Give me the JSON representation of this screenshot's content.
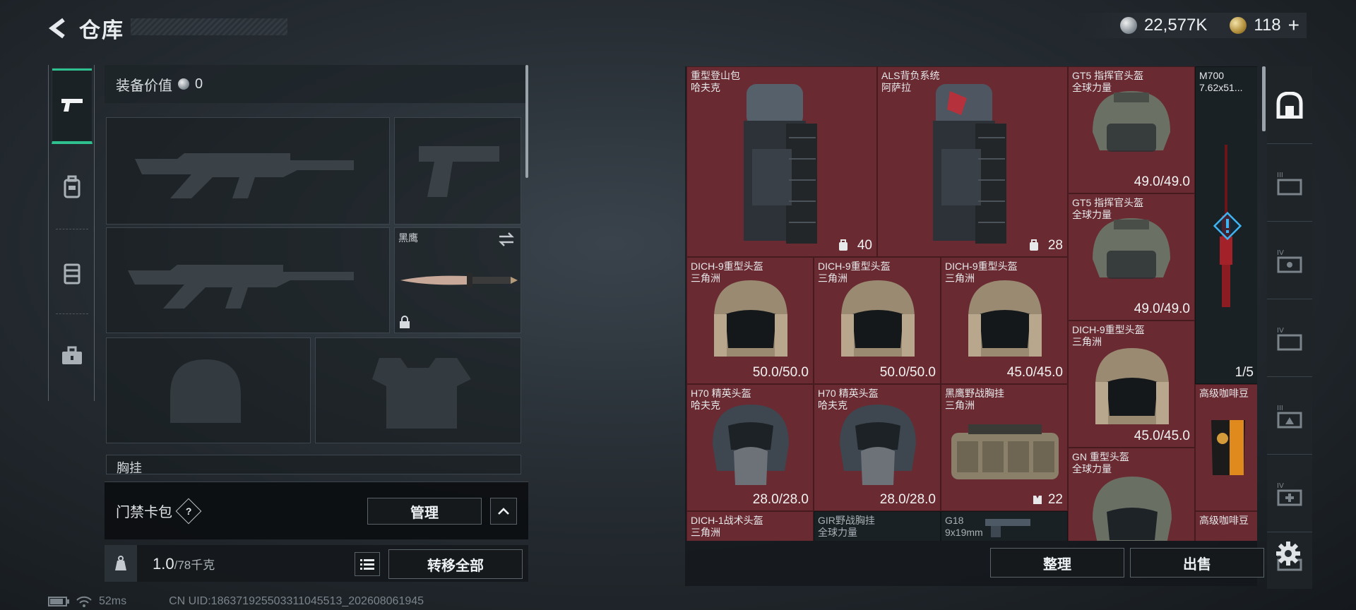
{
  "header": {
    "title": "仓库"
  },
  "currency": {
    "silver": "22,577K",
    "gold": "118",
    "add": "+"
  },
  "left_nav": {
    "tabs": [
      "gun-icon",
      "backpack-icon",
      "armor-icon",
      "toolbox-icon"
    ],
    "active": 0
  },
  "equipment": {
    "value_label": "装备价值",
    "value": "0",
    "slots": {
      "melee_name": "黑鹰",
      "chest_label": "胸挂"
    }
  },
  "card_bag": {
    "label": "门禁卡包",
    "help": "?",
    "manage": "管理"
  },
  "weight": {
    "current": "1.0",
    "capacity": "/78千克",
    "transfer_all": "转移全部"
  },
  "status_bar": {
    "ping": "52ms",
    "uid": "CN UID:1863719255033110455​13_202608061945"
  },
  "inventory": {
    "items": [
      {
        "name": "重型登山包\n哈夫克",
        "value": "40",
        "bg": "red"
      },
      {
        "name": "ALS背负系统\n阿萨拉",
        "value": "28",
        "bg": "red"
      },
      {
        "name": "GT5 指挥官头盔\n全球力量",
        "value": "49.0/49.0",
        "bg": "red"
      },
      {
        "name": "M700\n7.62x51...",
        "value": "1/5",
        "bg": "dark"
      },
      {
        "name": "GT5 指挥官头盔\n全球力量",
        "value": "49.0/49.0",
        "bg": "red"
      },
      {
        "name": "DICH-9重型头盔\n三角洲",
        "value": "50.0/50.0",
        "bg": "red"
      },
      {
        "name": "DICH-9重型头盔\n三角洲",
        "value": "50.0/50.0",
        "bg": "red"
      },
      {
        "name": "DICH-9重型头盔\n三角洲",
        "value": "45.0/45.0",
        "bg": "red"
      },
      {
        "name": "DICH-9重型头盔\n三角洲",
        "value": "45.0/45.0",
        "bg": "red"
      },
      {
        "name": "H70 精英头盔\n哈夫克",
        "value": "28.0/28.0",
        "bg": "red"
      },
      {
        "name": "H70 精英头盔\n哈夫克",
        "value": "28.0/28.0",
        "bg": "red"
      },
      {
        "name": "黑鹰野战胸挂\n三角洲",
        "value": "22",
        "bg": "red"
      },
      {
        "name": "高级咖啡豆",
        "value": "",
        "bg": "red"
      },
      {
        "name": "GN 重型头盔\n全球力量",
        "value": "",
        "bg": "red"
      },
      {
        "name": "DICH-1战术头盔\n三角洲",
        "value": "",
        "bg": "red"
      },
      {
        "name": "GIR野战胸挂\n全球力量",
        "value": "",
        "bg": "dark"
      },
      {
        "name": "G18\n9x19mm",
        "value": "",
        "bg": "dark"
      },
      {
        "name": "高级咖啡豆",
        "value": "",
        "bg": "red"
      }
    ],
    "sort_button": "整理",
    "sell_button": "出售"
  },
  "right_side": {
    "tabs": [
      "safe-icon",
      "tier3-case-icon",
      "tier4-case-icon",
      "tier4-case-icon",
      "tier3-case-icon",
      "tier4-medkit-icon",
      "tier3-case-icon"
    ]
  },
  "colors": {
    "accent": "#2ec18f",
    "item_red": "#6a2a32",
    "item_dark": "#1a2125"
  }
}
